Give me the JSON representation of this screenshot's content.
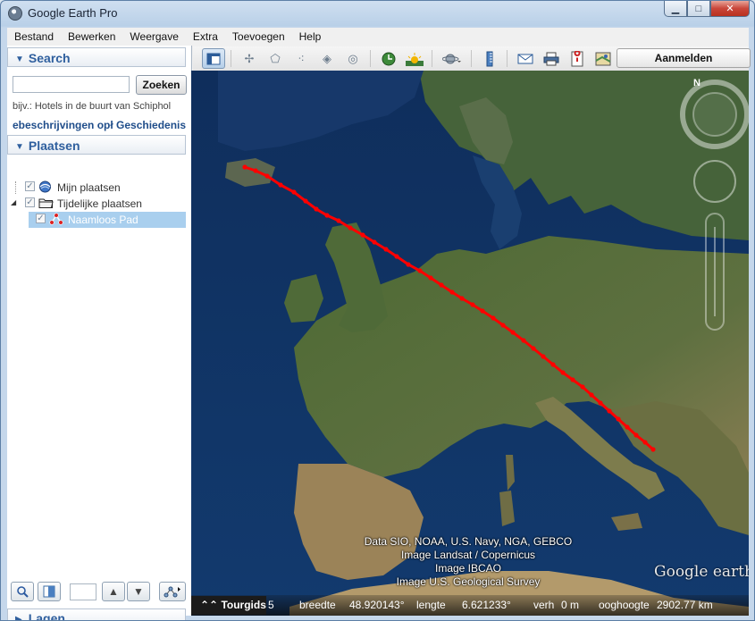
{
  "window": {
    "title": "Google Earth Pro"
  },
  "window_buttons": {
    "minimize": "▁",
    "maximize": "□",
    "close": "✕"
  },
  "menu": [
    "Bestand",
    "Bewerken",
    "Weergave",
    "Extra",
    "Toevoegen",
    "Help"
  ],
  "search": {
    "header": "Search",
    "placeholder": "",
    "value": "",
    "button": "Zoeken",
    "example": "bijv.: Hotels in de buurt van Schiphol",
    "links": "ebeschrijvingen opł Geschiedenis"
  },
  "places": {
    "header": "Plaatsen",
    "items": [
      {
        "label": "Mijn plaatsen",
        "icon": "globe-icon",
        "checked": true
      },
      {
        "label": "Tijdelijke plaatsen",
        "icon": "folder-icon",
        "checked": true
      },
      {
        "label": "Naamloos Pad",
        "icon": "path-icon",
        "checked": true,
        "selected": true
      }
    ]
  },
  "layers": {
    "header": "Lagen"
  },
  "toolbar": {
    "signin": "Aanmelden",
    "icons": [
      "sidebar-toggle-icon",
      "placemark-icon",
      "polygon-icon",
      "path-icon",
      "overlay-icon",
      "tour-icon",
      "historical-imagery-icon",
      "sunlight-icon",
      "planets-icon",
      "ruler-icon",
      "email-icon",
      "print-icon",
      "save-image-icon",
      "view-in-maps-icon"
    ]
  },
  "map": {
    "attribution": [
      "Data SIO, NOAA, U.S. Navy, NGA, GEBCO",
      "Image Landsat / Copernicus",
      "Image IBCAO",
      "Image U.S. Geological Survey"
    ],
    "brand": "Google earth",
    "compass_north": "N",
    "path_color": "#ff0000"
  },
  "status": {
    "tourguide": "Tourgids",
    "prefix": "5",
    "lat_label": "breedte",
    "lat_value": "48.920143°",
    "lon_label": "lengte",
    "lon_value": "6.621233°",
    "elev_label": "verh",
    "elev_value": "0 m",
    "eye_label": "ooghoogte",
    "eye_value": "2902.77 km"
  }
}
